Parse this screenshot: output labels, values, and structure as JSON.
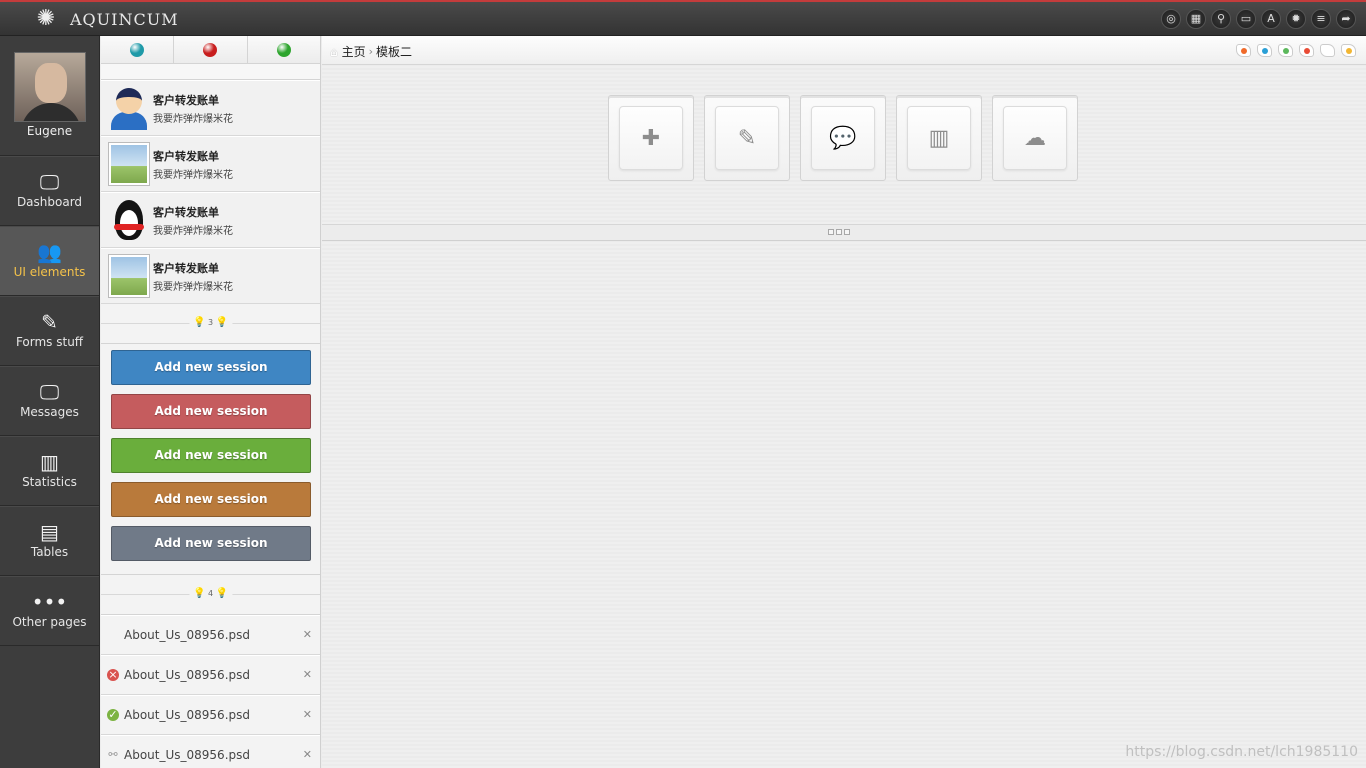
{
  "app": {
    "name": "AQUINCUM"
  },
  "top_icons": [
    "settings-circle-icon",
    "grid-icon",
    "search-icon",
    "monitor-icon",
    "font-icon",
    "gear-icon",
    "menu-icon",
    "share-icon"
  ],
  "user": {
    "name": "Eugene"
  },
  "nav": [
    {
      "label": "Dashboard",
      "icon": "monitor-icon",
      "active": false
    },
    {
      "label": "UI elements",
      "icon": "users-icon",
      "active": true
    },
    {
      "label": "Forms stuff",
      "icon": "edit-icon",
      "active": false
    },
    {
      "label": "Messages",
      "icon": "monitor-icon",
      "active": false
    },
    {
      "label": "Statistics",
      "icon": "chart-icon",
      "active": false
    },
    {
      "label": "Tables",
      "icon": "table-icon",
      "active": false
    },
    {
      "label": "Other pages",
      "icon": "dots-icon",
      "active": false
    }
  ],
  "status_dots": {
    "colors": [
      "#1f9aa8",
      "#c81e1e",
      "#2ea52e"
    ]
  },
  "contacts": [
    {
      "name": "客户转发账单",
      "message": "我要炸弹炸爆米花",
      "avatar": "person"
    },
    {
      "name": "客户转发账单",
      "message": "我要炸弹炸爆米花",
      "avatar": "photo"
    },
    {
      "name": "客户转发账单",
      "message": "我要炸弹炸爆米花",
      "avatar": "penguin"
    },
    {
      "name": "客户转发账单",
      "message": "我要炸弹炸爆米花",
      "avatar": "photo"
    }
  ],
  "divider_counts": {
    "first": "3",
    "second": "4"
  },
  "session_buttons": [
    {
      "label": "Add new session",
      "color": "#3f86c3"
    },
    {
      "label": "Add new session",
      "color": "#c55c5e"
    },
    {
      "label": "Add new session",
      "color": "#6aae3c"
    },
    {
      "label": "Add new session",
      "color": "#b97a3b"
    },
    {
      "label": "Add new session",
      "color": "#707a88"
    }
  ],
  "files": [
    {
      "name": "About_Us_08956.psd",
      "status": "none"
    },
    {
      "name": "About_Us_08956.psd",
      "status": "error",
      "color": "#d9534f"
    },
    {
      "name": "About_Us_08956.psd",
      "status": "success",
      "color": "#7cb342"
    },
    {
      "name": "About_Us_08956.psd",
      "status": "link"
    }
  ],
  "breadcrumb": {
    "home": "主页",
    "current": "模板二"
  },
  "theme_swatches": [
    "#f06a2a",
    "#2a9fd6",
    "#5cb85c",
    "#e94b35",
    "#ffffff",
    "#f2b632"
  ],
  "quick_actions": [
    "add-icon",
    "edit-icon",
    "comments-icon",
    "chart-icon",
    "cloud-upload-icon"
  ],
  "watermark": "https://blog.csdn.net/lch1985110"
}
